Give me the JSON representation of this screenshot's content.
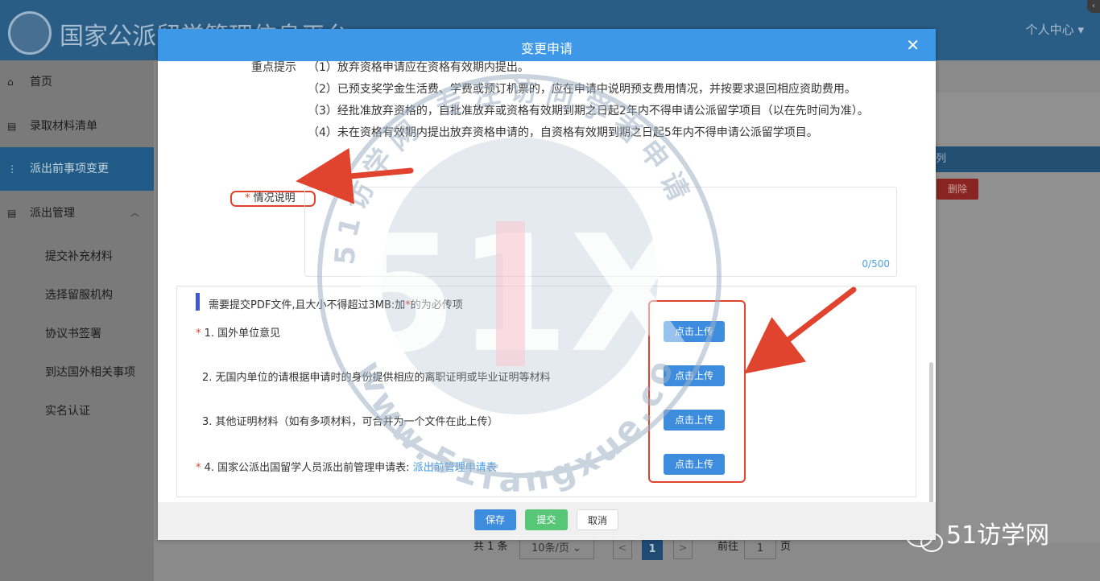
{
  "app": {
    "title": "国家公派留学管理信息平台",
    "user_menu": "个人中心",
    "collapse_icon": "‹"
  },
  "sidebar": {
    "items": [
      {
        "label": "首页",
        "icon": "home-icon"
      },
      {
        "label": "录取材料清单",
        "icon": "document-icon"
      },
      {
        "label": "派出前事项变更",
        "icon": "sitemap-icon",
        "active": true
      },
      {
        "label": "派出管理",
        "icon": "document-icon",
        "expanded": true
      }
    ],
    "subitems": [
      "提交补充材料",
      "选择留服机构",
      "协议书签署",
      "到达国外相关事项",
      "实名认证"
    ]
  },
  "background": {
    "table_header": "列",
    "delete_label": "删除",
    "pagination": {
      "total": "共 1 条",
      "page_size": "10条/页",
      "prev": "<",
      "current": "1",
      "next": ">",
      "goto_label": "前往",
      "goto_value": "1",
      "page_suffix": "页"
    }
  },
  "modal": {
    "title": "变更申请",
    "close": "✕",
    "notice_label": "重点提示",
    "notice_lines": [
      "（1）放弃资格申请应在资格有效期内提出。",
      "（2）已预支奖学金生活费、学费或预订机票的，应在申请中说明预支费用情况，并按要求退回相应资助费用。",
      "（3）经批准放弃资格的，自批准放弃或资格有效期到期之日起2年内不得申请公派留学项目（以在先时间为准）。",
      "（4）未在资格有效期内提出放弃资格申请的，自资格有效期到期之日起5年内不得申请公派留学项目。"
    ],
    "desc_required": "*",
    "desc_label": "情况说明",
    "textarea_counter": "0/500",
    "tip": {
      "before": "需要提交PDF文件,且大小不得超过3MB:加",
      "star": "*",
      "after": "的为必传项"
    },
    "files": [
      {
        "required": true,
        "label": "1. 国外单位意见",
        "upload": "点击上传"
      },
      {
        "required": false,
        "label": "2. 无国内单位的请根据申请时的身份提供相应的离职证明或毕业证明等材料",
        "upload": "点击上传"
      },
      {
        "required": false,
        "label": "3. 其他证明材料（如有多项材料，可合并为一个文件在此上传）",
        "upload": "点击上传"
      },
      {
        "required": true,
        "label": "4. 国家公派出国留学人员派出前管理申请表:",
        "link": "派出前管理申请表",
        "upload": "点击上传"
      }
    ],
    "footer": {
      "save": "保存",
      "submit": "提交",
      "cancel": "取消"
    }
  },
  "watermark": {
    "center_text": "51X",
    "url": "www.51fangxue.com",
    "arc_text": "51访学网 专注访问学者申请"
  },
  "branding": {
    "wechat_account": "51访学网"
  },
  "colors": {
    "header_blue": "#3d99e8",
    "upload_blue": "#3d8cde",
    "submit_green": "#57c777",
    "required_red": "#e1442e",
    "annotation_red": "#e1442e"
  }
}
